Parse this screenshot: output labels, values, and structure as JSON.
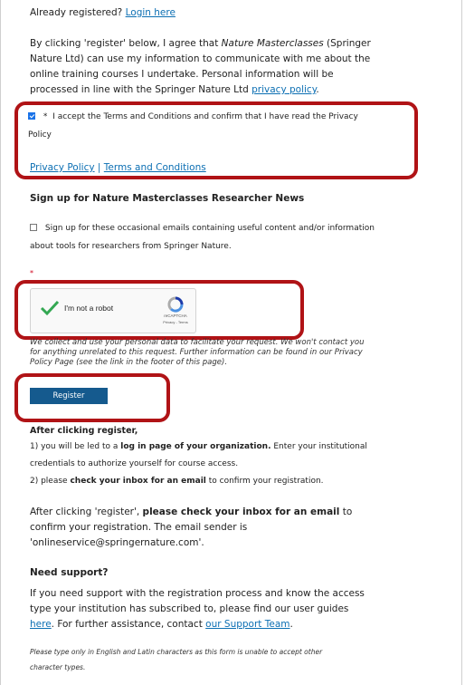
{
  "login": {
    "prompt": "Already registered?",
    "link": "Login here"
  },
  "consent": {
    "part1": "By clicking 'register' below, I agree that",
    "brand": "Nature Masterclasses",
    "part2": "(Springer",
    "line2": "Nature Ltd) can use my information to communicate with me about the",
    "line3": "online training courses I undertake. Personal information will be",
    "line4_pre": "processed in line with the Springer Nature Ltd",
    "privacy_link": "privacy policy",
    "line4_post": "."
  },
  "terms_checkbox": {
    "checked": true,
    "asterisk": "*",
    "line1": "I accept the Terms and Conditions and confirm that I have read the Privacy",
    "line2": "Policy"
  },
  "policy_links": {
    "privacy": "Privacy Policy",
    "sep": "|",
    "terms": "Terms and Conditions"
  },
  "newsletter": {
    "heading": "Sign up for Nature Masterclasses Researcher News",
    "checked": false,
    "line1": "Sign up for these occasional emails containing useful content and/or information",
    "line2": "about tools for researchers from Springer Nature."
  },
  "required_mark": "*",
  "captcha": {
    "label": "I'm not a robot",
    "brand": "reCAPTCHA",
    "links": "Privacy - Terms"
  },
  "data_notice": {
    "line1": "We collect and use your personal data to facilitate your request. We won't contact you",
    "line2": "for anything unrelated to this request. Further information can be found in our Privacy",
    "line3": "Policy Page (see the link in the footer of this page)."
  },
  "register_button": "Register",
  "after": {
    "heading": "After clicking register,",
    "s1_pre": "1) you will be led to a",
    "s1_bold": "log in page of your organization.",
    "s1_post": "Enter your institutional",
    "s1_line2": "credentials to authorize yourself for course access.",
    "s2_pre": "2) please",
    "s2_bold": "check your inbox for an email",
    "s2_post": "to confirm your registration."
  },
  "email_note": {
    "pre": "After clicking 'register',",
    "bold": "please check your inbox for an email",
    "post": "to",
    "line2": "confirm your registration. The email sender is",
    "line3": "'onlineservice@springernature.com'."
  },
  "support": {
    "heading": "Need support?",
    "line1": "If you need support with the registration process and know the access",
    "line2": "type your institution has subscribed to, please find our user guides",
    "here": "here",
    "line3_mid": ". For further assistance, contact",
    "team_link": "our Support Team",
    "line3_end": "."
  },
  "charset_note": {
    "line1": "Please type only in English and Latin characters as this form is unable to accept other",
    "line2": "character types."
  },
  "colors": {
    "link": "#0c6fb3",
    "highlight": "#b01316",
    "button": "#155a8e",
    "check": "#34a853"
  }
}
